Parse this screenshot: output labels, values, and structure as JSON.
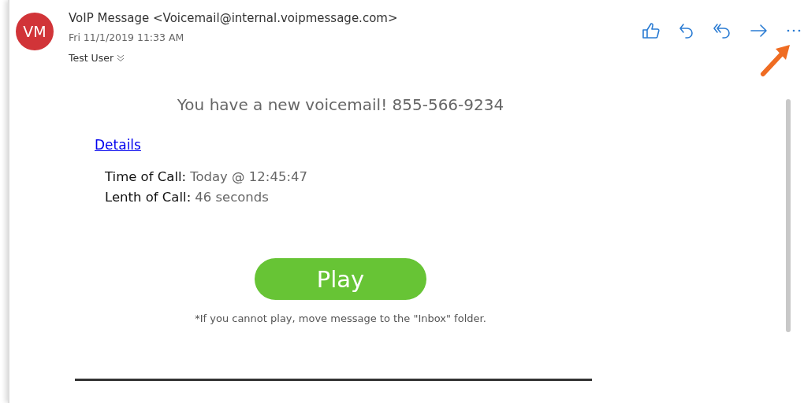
{
  "sender": {
    "initials": "VM",
    "name": "VoIP Message <Voicemail@internal.voipmessage.com>",
    "date": "Fri 11/1/2019 11:33 AM",
    "recipient": "Test User"
  },
  "actions": [
    {
      "kind": "like"
    },
    {
      "kind": "reply"
    },
    {
      "kind": "reply_all"
    },
    {
      "kind": "forward"
    },
    {
      "kind": "more"
    }
  ],
  "body": {
    "headline": "You have a new voicemail! 855-566-9234",
    "details_link": "Details",
    "fields": [
      {
        "label": "Time of Call:",
        "value": "Today @ 12:45:47"
      },
      {
        "label": "Lenth of Call:",
        "value": "46 seconds"
      }
    ],
    "play_button": "Play",
    "note": "*If you cannot play, move message to the \"Inbox\" folder."
  }
}
